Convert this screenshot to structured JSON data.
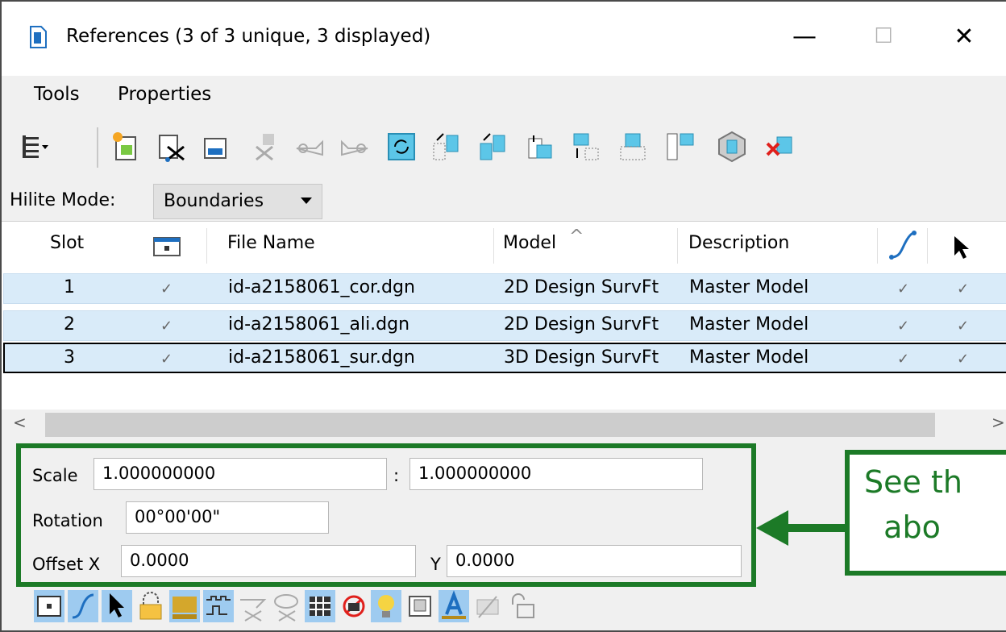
{
  "window": {
    "title": "References (3 of 3 unique, 3 displayed)",
    "minimize_glyph": "—",
    "maximize_glyph": "☐",
    "close_glyph": "✕"
  },
  "menu": {
    "items": [
      {
        "label": "Tools"
      },
      {
        "label": "Properties"
      }
    ]
  },
  "toolbar": {
    "icons": [
      "tree-view-icon",
      "attach-reference-icon",
      "detach-reference-icon",
      "reload-reference-icon",
      "exchange-icon",
      "move-icon",
      "copy-icon",
      "refresh-icon",
      "rotate-icon",
      "mirror-horizontal-icon",
      "mirror-vertical-icon",
      "clip-boundary-icon",
      "clip-mask-icon",
      "clip-front-icon",
      "clip-back-icon",
      "delete-clip-icon",
      "clip-delete-icon"
    ]
  },
  "hilite": {
    "label": "Hilite Mode:",
    "value": "Boundaries"
  },
  "table": {
    "headers": {
      "slot": "Slot",
      "file_name": "File Name",
      "model": "Model",
      "sort_glyph": "^",
      "description": "Description"
    },
    "rows": [
      {
        "slot": "1",
        "display": "✓",
        "file_name": "id-a2158061_cor.dgn",
        "model": "2D Design SurvFt",
        "description": "Master Model",
        "snap": "✓",
        "locate": "✓"
      },
      {
        "slot": "2",
        "display": "✓",
        "file_name": "id-a2158061_ali.dgn",
        "model": "2D Design SurvFt",
        "description": "Master Model",
        "snap": "✓",
        "locate": "✓"
      },
      {
        "slot": "3",
        "display": "✓",
        "file_name": "id-a2158061_sur.dgn",
        "model": "3D Design SurvFt",
        "description": "Master Model",
        "snap": "✓",
        "locate": "✓"
      }
    ]
  },
  "scrollbar": {
    "left_glyph": "<",
    "right_glyph": ">"
  },
  "fields": {
    "scale_label": "Scale",
    "scale_left": "1.000000000",
    "scale_sep": ":",
    "scale_right": "1.000000000",
    "rotation_label": "Rotation",
    "rotation_value": "00°00'00\"",
    "offset_x_label": "Offset X",
    "offset_x_value": "0.0000",
    "offset_y_label": "Y",
    "offset_y_value": "0.0000"
  },
  "callout": {
    "text": "See th\n  abo"
  },
  "colors": {
    "accent_green": "#1c7a27",
    "row_highlight": "#d9ebf9"
  }
}
